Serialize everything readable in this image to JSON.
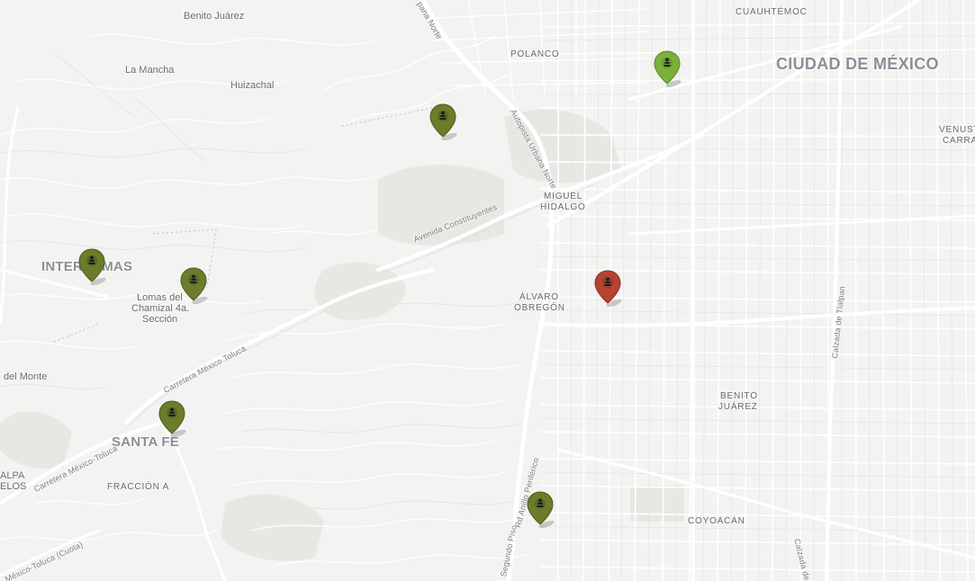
{
  "map": {
    "colors": {
      "background": "#f3f3f1",
      "road": "#ffffff",
      "road_casing": "#dcdcdc",
      "park": "#e4e8e2",
      "marker_green": "#6b7d2a",
      "marker_green_light": "#7bb03a",
      "marker_red": "#b4432f",
      "marker_icon": "#2b2b2b"
    },
    "labels": {
      "ciudad_de_mexico": "CIUDAD DE MÉXICO",
      "cuauhtemoc": "CUAUHTÉMOC",
      "polanco": "POLANCO",
      "miguel_hidalgo_1": "MIGUEL",
      "miguel_hidalgo_2": "HIDALGO",
      "alvaro_obregon_1": "ÁLVARO",
      "alvaro_obregon_2": "OBREGÓN",
      "benito_juarez_1": "BENITO",
      "benito_juarez_2": "JUÁREZ",
      "coyoacan": "COYOACÁN",
      "venustiano_1": "VENUST",
      "venustiano_2": "CARRA",
      "interlomas": "INTERLOMAS",
      "santa_fe": "SANTA FE",
      "fraccion_a": "FRACCIÓN A",
      "benito_juarez_town": "Benito Juárez",
      "la_mancha": "La Mancha",
      "huizachal": "Huizachal",
      "lomas_chamizal_1": "Lomas del",
      "lomas_chamizal_2": "Chamizal 4a.",
      "lomas_chamizal_3": "Sección",
      "del_monte": "del Monte",
      "alpa_1": "ALPA",
      "alpa_2": "ELOS"
    },
    "streets": {
      "avenida_constituyentes": "Avenida Constituyentes",
      "autopista_urbana_norte": "Autopista Urbana Norte",
      "carretera_mexico_toluca_1": "Carretera México Toluca",
      "carretera_mexico_toluca_2": "Carretera México-Toluca",
      "mexico_toluca_cuota": "México-Toluca (Cuota)",
      "anillo_periferico": "Rd Anillo Periférico",
      "segundo_piso": "Segundo Piso",
      "calzada_de_tlalpan": "Calzada de Tlalpan",
      "calzada_de": "Calzada de",
      "pana_norte": "pana Norte"
    },
    "markers": [
      {
        "id": "polanco-station",
        "color": "light-green",
        "icon": "person-icon"
      },
      {
        "id": "lomas-station",
        "color": "green",
        "icon": "person-icon"
      },
      {
        "id": "interlomas-station",
        "color": "green",
        "icon": "person-icon"
      },
      {
        "id": "chamizal-station",
        "color": "green",
        "icon": "person-icon"
      },
      {
        "id": "santa-fe-station",
        "color": "green",
        "icon": "person-icon"
      },
      {
        "id": "periferico-station",
        "color": "green",
        "icon": "person-icon"
      },
      {
        "id": "selected-station",
        "color": "red",
        "icon": "person-icon"
      }
    ]
  }
}
